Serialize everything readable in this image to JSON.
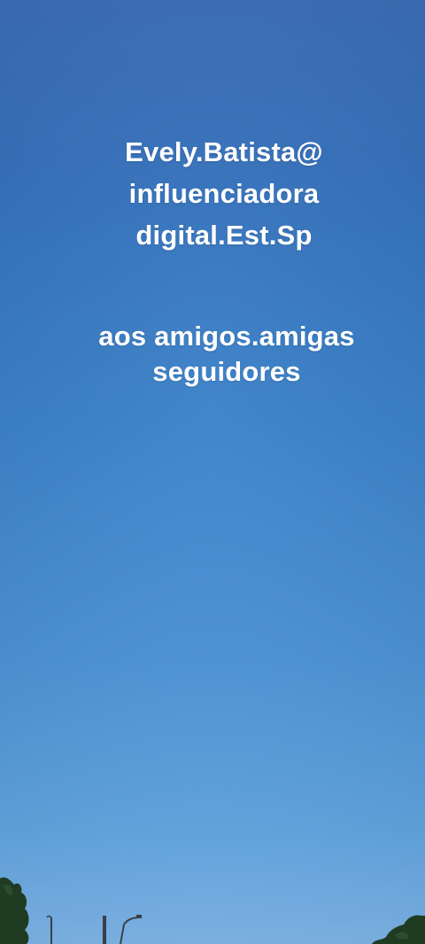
{
  "caption_top": {
    "lines": [
      "Evely.Batista@",
      "influenciadora",
      "digital.Est.Sp"
    ]
  },
  "caption_bottom": {
    "lines": [
      "aos amigos.amigas",
      "seguidores"
    ]
  },
  "colors": {
    "sky_top": "#3a6db6",
    "sky_bottom": "#7fb6ea",
    "text": "#ffffff",
    "foliage": "#1f3b22"
  }
}
